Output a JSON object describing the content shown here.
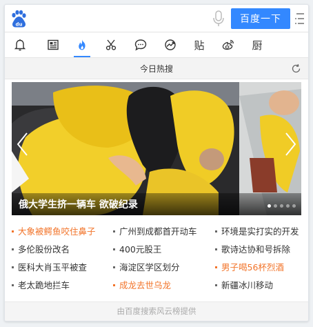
{
  "search": {
    "button_label": "百度一下"
  },
  "tabs": [
    {
      "name": "tab-notifications",
      "icon": "bell-icon"
    },
    {
      "name": "tab-news",
      "icon": "newspaper-icon"
    },
    {
      "name": "tab-hot",
      "icon": "flame-icon",
      "active": true
    },
    {
      "name": "tab-tools",
      "icon": "scissors-icon"
    },
    {
      "name": "tab-chat",
      "icon": "chat-bubble-icon"
    },
    {
      "name": "tab-finance",
      "icon": "trend-icon"
    },
    {
      "name": "tab-tieba",
      "icon": "tieba-icon",
      "label": "贴"
    },
    {
      "name": "tab-weibo",
      "icon": "weibo-icon"
    },
    {
      "name": "tab-kitchen",
      "icon": "kitchen-icon",
      "label": "厨"
    }
  ],
  "hot": {
    "title": "今日热搜",
    "banner_caption": "俄大学生挤一辆车 欲破纪录",
    "slides_total": 5,
    "slide_active": 1,
    "items": [
      [
        "大象被鳄鱼咬住鼻子",
        "广州到成都首开动车",
        "环境是实打实的开发"
      ],
      [
        "多伦股份改名",
        "400元股王",
        "歌诗达协和号拆除"
      ],
      [
        "医科大肖玉平被查",
        "海淀区学区划分",
        "男子喝56杯烈酒"
      ],
      [
        "老太跪地拦车",
        "成龙去世乌龙",
        "新疆冰川移动"
      ]
    ],
    "highlighted": [
      [
        0,
        0
      ],
      [
        2,
        2
      ],
      [
        3,
        1
      ]
    ]
  },
  "footer": {
    "text": "由百度搜索风云榜提供"
  },
  "colors": {
    "accent": "#3388ff",
    "hot": "#f2742a"
  }
}
